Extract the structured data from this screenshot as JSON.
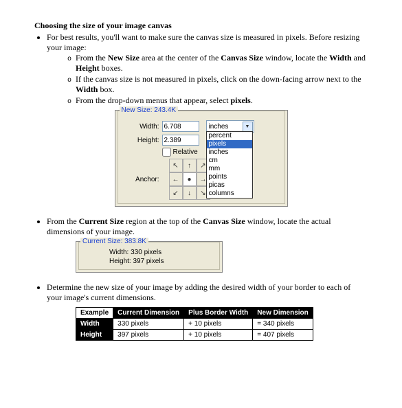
{
  "heading": "Choosing the size of your image canvas",
  "intro": "For best results, you'll want to make sure the canvas size is measured in pixels.  Before resizing your image:",
  "sub1_a": "From the ",
  "sub1_b": "New Size",
  "sub1_c": " area at the center of the ",
  "sub1_d": "Canvas Size",
  "sub1_e": " window, locate the ",
  "sub1_f": "Width",
  "sub1_g": " and ",
  "sub1_h": "Height",
  "sub1_i": " boxes.",
  "sub2_a": "If the canvas size is not measured in pixels, click on the down-facing arrow next to the ",
  "sub2_b": "Width",
  "sub2_c": " box.",
  "sub3_a": "From the drop-down menus that appear, select ",
  "sub3_b": "pixels",
  "sub3_c": ".",
  "panel1": {
    "legend": "New Size: 243.4K",
    "width_label": "Width:",
    "width_val": "6.708",
    "height_label": "Height:",
    "height_val": "2.389",
    "unit_sel": "inches",
    "relative": "Relative",
    "anchor_label": "Anchor:",
    "options": [
      "percent",
      "pixels",
      "inches",
      "cm",
      "mm",
      "points",
      "picas",
      "columns"
    ]
  },
  "line2_a": "From the ",
  "line2_b": "Current Size",
  "line2_c": " region at the top of the ",
  "line2_d": "Canvas Size",
  "line2_e": " window, locate the actual dimensions of your image.",
  "panel2": {
    "legend": "Current Size: 383.8K",
    "width": "Width:  330 pixels",
    "height": "Height:  397 pixels"
  },
  "line3": "Determine the new size of your image by adding the desired width of your border to each of your image's current dimensions.",
  "table": {
    "h": [
      "Example",
      "Current Dimension",
      "Plus Border Width",
      "New Dimension"
    ],
    "r1": [
      "Width",
      "330 pixels",
      "+ 10 pixels",
      "= 340 pixels"
    ],
    "r2": [
      "Height",
      "397 pixels",
      "+ 10 pixels",
      "= 407 pixels"
    ]
  }
}
